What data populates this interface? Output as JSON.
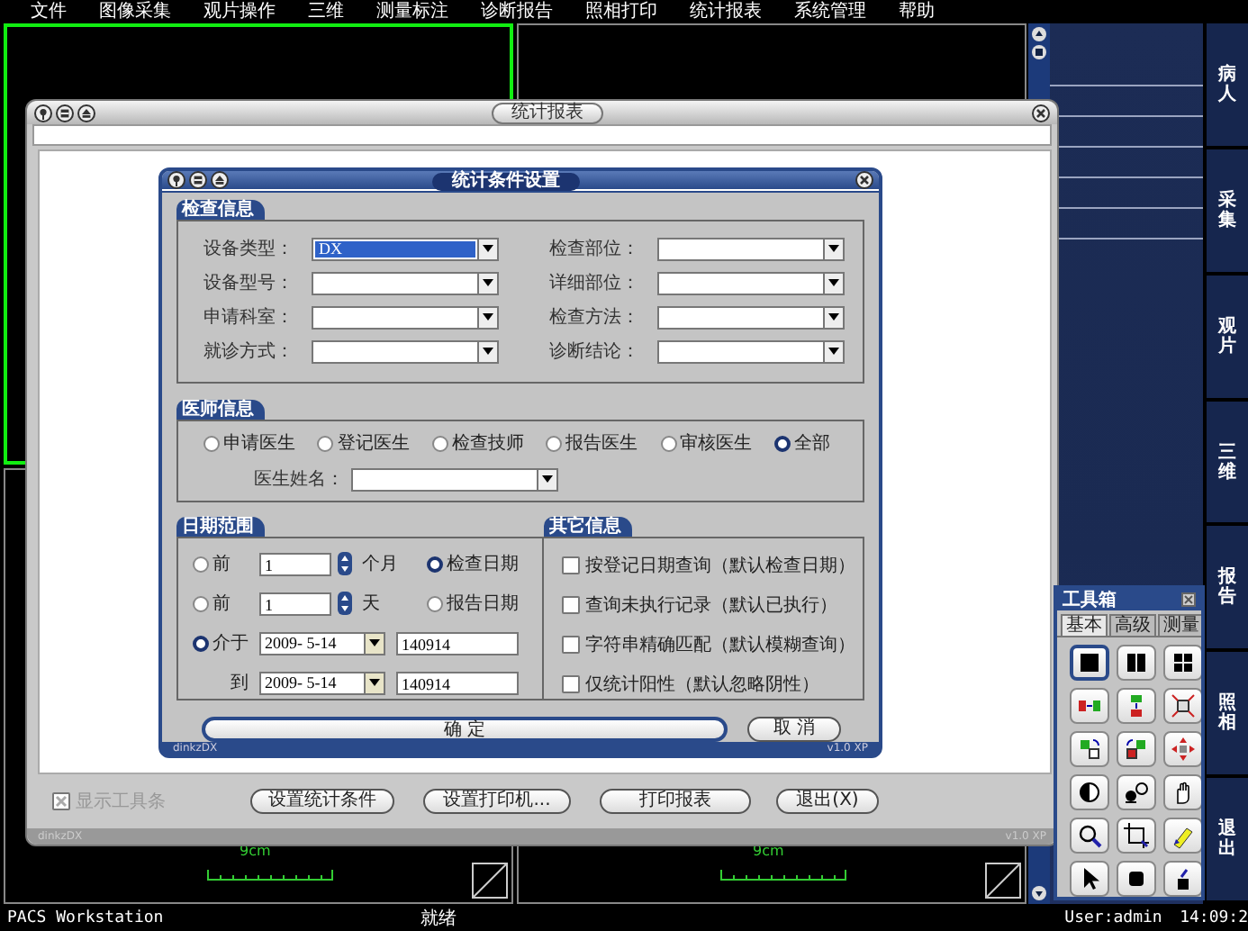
{
  "menu": [
    "文件",
    "图像采集",
    "观片操作",
    "三维",
    "测量标注",
    "诊断报告",
    "照相打印",
    "统计报表",
    "系统管理",
    "帮助"
  ],
  "viewports": [
    {
      "selected": true
    },
    {
      "selected": false
    },
    {
      "selected": false,
      "scale": "9cm"
    },
    {
      "selected": false,
      "scale": "9cm"
    }
  ],
  "side_tabs": [
    "病人",
    "采集",
    "观片",
    "三维",
    "报告",
    "照相",
    "退出"
  ],
  "toolbox": {
    "title": "工具箱",
    "tabs": [
      {
        "label": "基本",
        "selected": true
      },
      {
        "label": "高级",
        "selected": false
      },
      {
        "label": "测量",
        "selected": false
      }
    ],
    "tools": [
      {
        "kind": "single-pane",
        "selected": true
      },
      {
        "kind": "two-pane",
        "selected": false
      },
      {
        "kind": "four-pane",
        "selected": false
      },
      {
        "kind": "mirror",
        "selected": false
      },
      {
        "kind": "flip",
        "selected": false
      },
      {
        "kind": "fit",
        "selected": false
      },
      {
        "kind": "rotate-right",
        "selected": false
      },
      {
        "kind": "rotate-left",
        "selected": false
      },
      {
        "kind": "move",
        "selected": false
      },
      {
        "kind": "invert",
        "selected": false
      },
      {
        "kind": "contrast",
        "selected": false
      },
      {
        "kind": "hand",
        "selected": false
      },
      {
        "kind": "magnifier",
        "selected": false
      },
      {
        "kind": "crop",
        "selected": false
      },
      {
        "kind": "pen",
        "selected": false
      },
      {
        "kind": "pointer",
        "selected": false
      },
      {
        "kind": "stop",
        "selected": false
      },
      {
        "kind": "eraser",
        "selected": false
      }
    ]
  },
  "report_window": {
    "title": "统计报表",
    "show_toolbar": {
      "label": "显示工具条",
      "checked": true,
      "disabled": true
    },
    "buttons": [
      "设置统计条件",
      "设置打印机...",
      "打印报表",
      "退出(X)"
    ],
    "footer_left": "dinkzDX",
    "footer_right": "v1.0 XP"
  },
  "dialog": {
    "title": "统计条件设置",
    "exam_info": {
      "legend": "检查信息",
      "fields": [
        {
          "label": "设备类型：",
          "value": "DX",
          "focused": true
        },
        {
          "label": "检查部位：",
          "focused": false
        },
        {
          "label": "设备型号：",
          "focused": false
        },
        {
          "label": "详细部位：",
          "focused": false
        },
        {
          "label": "申请科室：",
          "focused": false
        },
        {
          "label": "检查方法：",
          "focused": false
        },
        {
          "label": "就诊方式：",
          "focused": false
        },
        {
          "label": "诊断结论：",
          "focused": false
        }
      ]
    },
    "doctor_info": {
      "legend": "医师信息",
      "roles": [
        {
          "label": "申请医生",
          "selected": false
        },
        {
          "label": "登记医生",
          "selected": false
        },
        {
          "label": "检查技师",
          "selected": false
        },
        {
          "label": "报告医生",
          "selected": false
        },
        {
          "label": "审核医生",
          "selected": false
        },
        {
          "label": "全部",
          "selected": true
        }
      ],
      "name_label": "医生姓名："
    },
    "date_range": {
      "legend": "日期范围",
      "periods": [
        {
          "label": "前",
          "selected": false,
          "value": "1",
          "unit": "个月"
        },
        {
          "label": "前",
          "selected": false,
          "value": "1",
          "unit": "天"
        }
      ],
      "date_types": [
        {
          "label": "检查日期",
          "selected": true
        },
        {
          "label": "报告日期",
          "selected": false
        }
      ],
      "between": {
        "label": "介于",
        "selected": true,
        "date": "2009- 5-14",
        "time": "140914"
      },
      "to": {
        "label": "到",
        "date": "2009- 5-14",
        "time": "140914"
      }
    },
    "other_info": {
      "legend": "其它信息",
      "options": [
        {
          "label": "按登记日期查询（默认检查日期）",
          "checked": false
        },
        {
          "label": "查询未执行记录（默认已执行）",
          "checked": false
        },
        {
          "label": "字符串精确匹配（默认模糊查询）",
          "checked": false
        },
        {
          "label": "仅统计阳性（默认忽略阴性）",
          "checked": false
        }
      ]
    },
    "buttons": [
      "确 定",
      "取 消"
    ],
    "footer_left": "dinkzDX",
    "footer_right": "v1.0 XP"
  },
  "status_bar": {
    "app": "PACS Workstation",
    "state": "就绪",
    "user": "User:admin",
    "time": "14:09:2"
  }
}
